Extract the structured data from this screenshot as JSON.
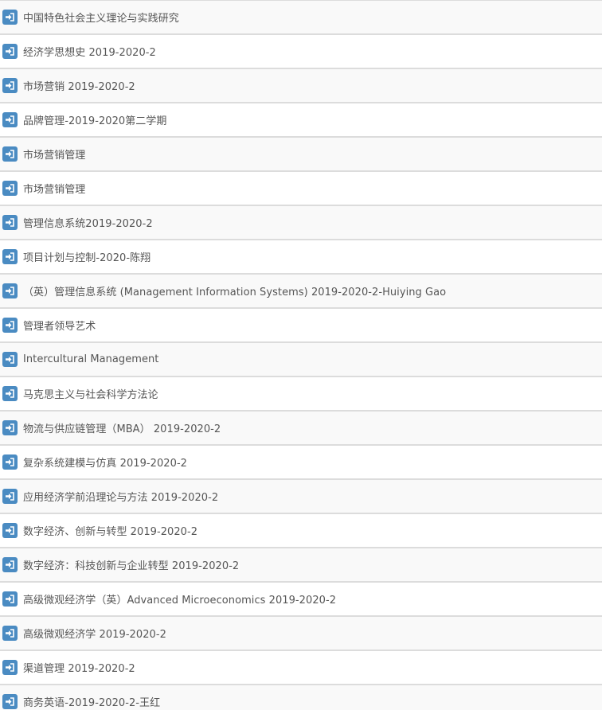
{
  "icon": {
    "name": "sign-in-icon",
    "color": "#4a8bc2"
  },
  "colors": {
    "row_odd": "#f9f9f9",
    "row_even": "#ffffff",
    "divider": "#dcdcdc",
    "text": "#555555"
  },
  "courses": [
    {
      "name": "中国特色社会主义理论与实践研究"
    },
    {
      "name": "经济学思想史 2019-2020-2"
    },
    {
      "name": "市场营销 2019-2020-2"
    },
    {
      "name": "品牌管理-2019-2020第二学期"
    },
    {
      "name": "市场营销管理"
    },
    {
      "name": "市场营销管理"
    },
    {
      "name": "管理信息系统2019-2020-2"
    },
    {
      "name": "项目计划与控制-2020-陈翔"
    },
    {
      "name": "（英）管理信息系统 (Management Information Systems) 2019-2020-2-Huiying Gao"
    },
    {
      "name": "管理者领导艺术"
    },
    {
      "name": "Intercultural Management"
    },
    {
      "name": "马克思主义与社会科学方法论"
    },
    {
      "name": "物流与供应链管理（MBA） 2019-2020-2"
    },
    {
      "name": "复杂系统建模与仿真 2019-2020-2"
    },
    {
      "name": "应用经济学前沿理论与方法 2019-2020-2"
    },
    {
      "name": "数字经济、创新与转型 2019-2020-2"
    },
    {
      "name": "数字经济：科技创新与企业转型 2019-2020-2"
    },
    {
      "name": "高级微观经济学（英）Advanced Microeconomics 2019-2020-2"
    },
    {
      "name": "高级微观经济学 2019-2020-2"
    },
    {
      "name": "渠道管理 2019-2020-2"
    },
    {
      "name": "商务英语-2019-2020-2-王红"
    }
  ]
}
